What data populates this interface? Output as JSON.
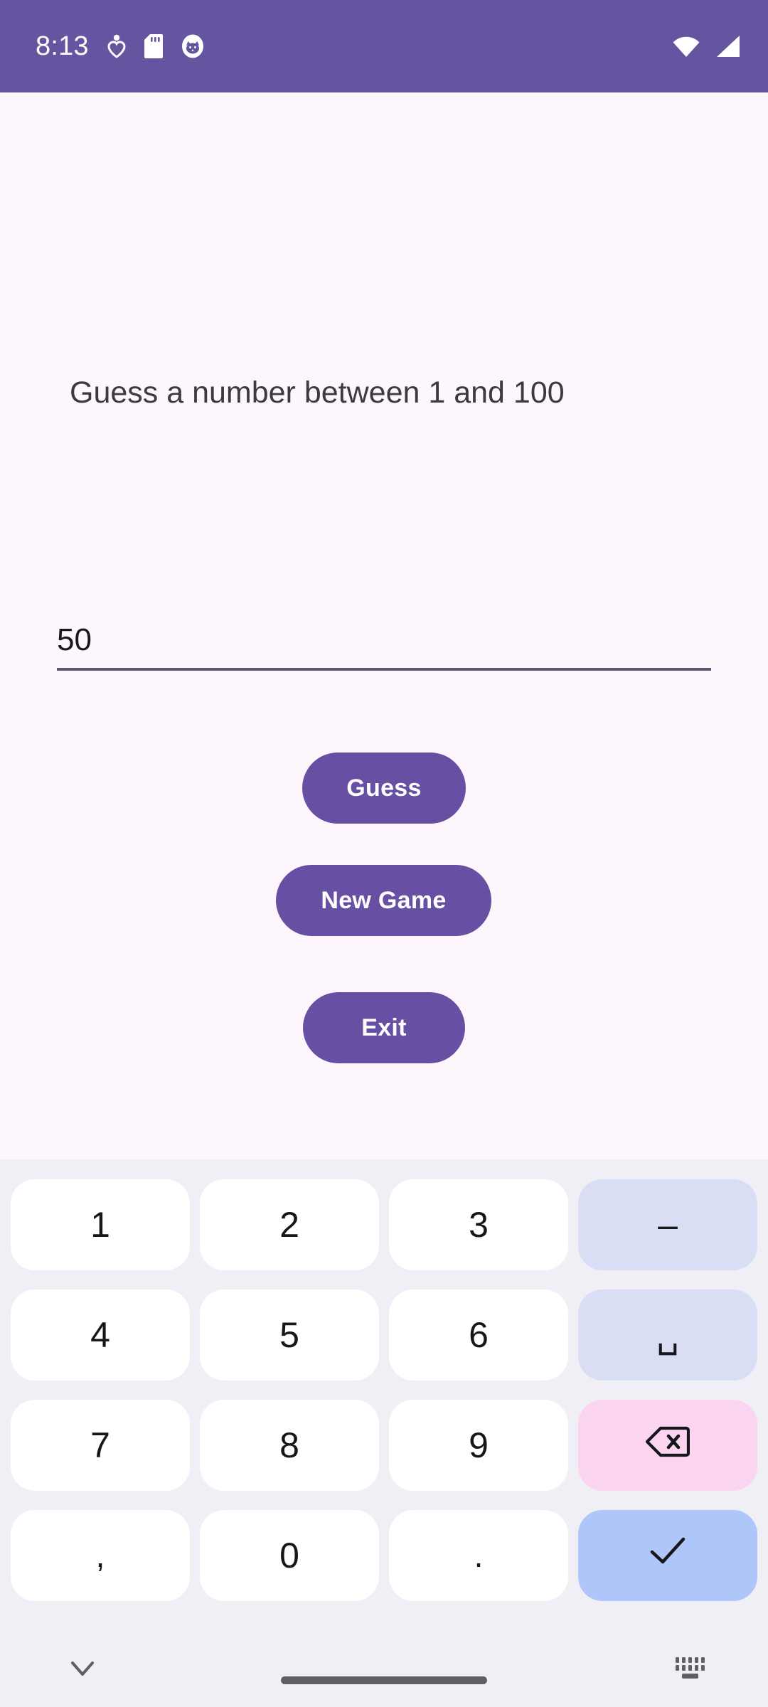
{
  "status_bar": {
    "time": "8:13",
    "background_color": "#65549F",
    "icons": [
      {
        "name": "heart-location-icon"
      },
      {
        "name": "sd-card-icon"
      },
      {
        "name": "cat-avatar-icon"
      }
    ],
    "right_icons": [
      {
        "name": "wifi-icon"
      },
      {
        "name": "cellular-signal-icon"
      }
    ]
  },
  "app": {
    "background_color": "#FDF7FD",
    "prompt": "Guess a number between 1 and 100",
    "input": {
      "value": "50",
      "placeholder": "",
      "underline_color": "#5E5770"
    },
    "buttons": {
      "guess": "Guess",
      "new_game": "New Game",
      "exit": "Exit",
      "color": "#6750A4",
      "text_color": "#FFFFFF"
    }
  },
  "keyboard": {
    "background_color": "#F0EFF5",
    "key_color": "#FFFFFF",
    "special_key_color": "#DADEF5",
    "backspace_key_color": "#FBD5F0",
    "enter_key_color": "#AEC6FA",
    "rows": [
      [
        {
          "label": "1",
          "name": "key-1",
          "type": "digit"
        },
        {
          "label": "2",
          "name": "key-2",
          "type": "digit"
        },
        {
          "label": "3",
          "name": "key-3",
          "type": "digit"
        },
        {
          "label": "–",
          "name": "key-minus",
          "type": "special"
        }
      ],
      [
        {
          "label": "4",
          "name": "key-4",
          "type": "digit"
        },
        {
          "label": "5",
          "name": "key-5",
          "type": "digit"
        },
        {
          "label": "6",
          "name": "key-6",
          "type": "digit"
        },
        {
          "label": "␣",
          "name": "key-space",
          "type": "special"
        }
      ],
      [
        {
          "label": "7",
          "name": "key-7",
          "type": "digit"
        },
        {
          "label": "8",
          "name": "key-8",
          "type": "digit"
        },
        {
          "label": "9",
          "name": "key-9",
          "type": "digit"
        },
        {
          "label": "",
          "name": "key-backspace",
          "type": "backspace"
        }
      ],
      [
        {
          "label": ",",
          "name": "key-comma",
          "type": "punct"
        },
        {
          "label": "0",
          "name": "key-0",
          "type": "digit"
        },
        {
          "label": ".",
          "name": "key-period",
          "type": "punct"
        },
        {
          "label": "",
          "name": "key-enter",
          "type": "enter"
        }
      ]
    ]
  },
  "nav_bar": {
    "background_color": "#F0EFF5",
    "hide_keyboard_icon": "chevron-down-icon",
    "home_indicator": "home-indicator",
    "switch_keyboard_icon": "keyboard-switch-icon"
  }
}
